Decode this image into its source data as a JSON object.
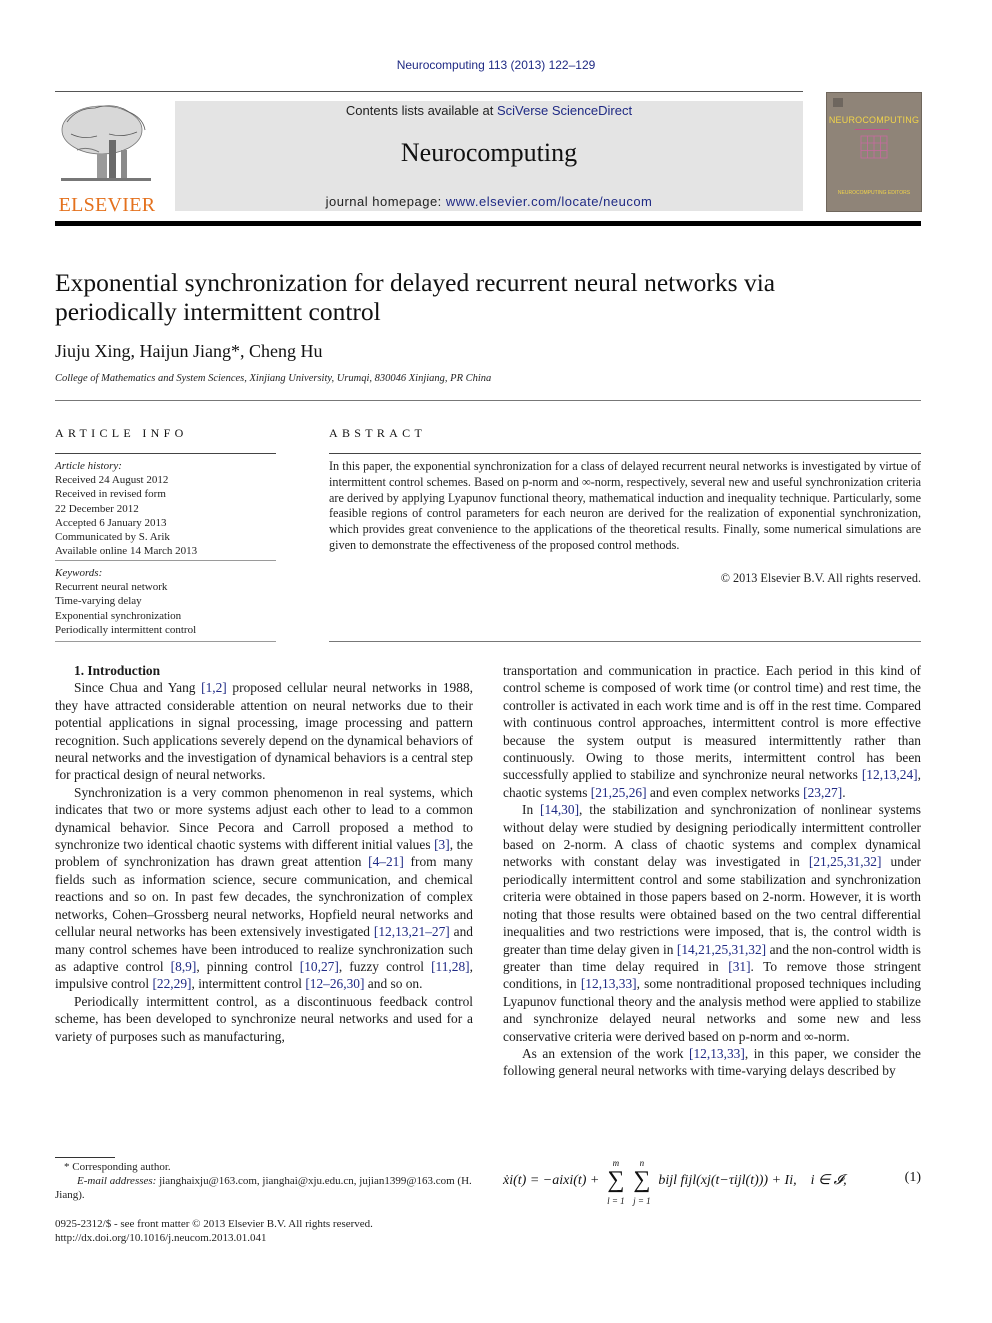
{
  "header": {
    "citation": "Neurocomputing 113 (2013) 122–129",
    "publisher_logo": "ELSEVIER",
    "contents_prefix": "Contents lists available at ",
    "contents_link": "SciVerse ScienceDirect",
    "journal_name": "Neurocomputing",
    "homepage_prefix": "journal homepage: ",
    "homepage_link": "www.elsevier.com/locate/neucom",
    "cover_title": "NEUROCOMPUTING",
    "cover_editors": "NEUROCOMPUTING EDITORS",
    "colors": {
      "link": "#1f2a84",
      "elsevier_orange": "#e4711d",
      "banner_bg": "#e4e4e4",
      "cover_bg": "#8f8478",
      "cover_text": "#f1d44a"
    }
  },
  "article": {
    "title": "Exponential synchronization for delayed recurrent neural networks via periodically intermittent control",
    "authors": "Jiuju Xing, Haijun Jiang*, Cheng Hu",
    "affiliation": "College of Mathematics and System Sciences, Xinjiang University, Urumqi, 830046 Xinjiang, PR China"
  },
  "article_info": {
    "heading": "ARTICLE INFO",
    "history_label": "Article history:",
    "history": [
      "Received 24 August 2012",
      "Received in revised form",
      "22 December 2012",
      "Accepted 6 January 2013",
      "Communicated by S. Arik",
      "Available online 14 March 2013"
    ],
    "keywords_label": "Keywords:",
    "keywords": [
      "Recurrent neural network",
      "Time-varying delay",
      "Exponential synchronization",
      "Periodically intermittent control"
    ]
  },
  "abstract": {
    "heading": "ABSTRACT",
    "text": "In this paper, the exponential synchronization for a class of delayed recurrent neural networks is investigated by virtue of intermittent control schemes. Based on p-norm and ∞-norm, respectively, several new and useful synchronization criteria are derived by applying Lyapunov functional theory, mathematical induction and inequality technique. Particularly, some feasible regions of control parameters for each neuron are derived for the realization of exponential synchronization, which provides great convenience to the applications of the theoretical results. Finally, some numerical simulations are given to demonstrate the effectiveness of the proposed control methods.",
    "copyright": "© 2013 Elsevier B.V. All rights reserved."
  },
  "body": {
    "section_title": "1.  Introduction",
    "left_paragraphs": [
      [
        "Since Chua and Yang ",
        {
          "ref": "[1,2]"
        },
        " proposed cellular neural networks in 1988, they have attracted considerable attention on neural networks due to their potential applications in signal processing, image processing and pattern recognition. Such applications severely depend on the dynamical behaviors of neural networks and the investigation of dynamical behaviors is a central step for practical design of neural networks."
      ],
      [
        "Synchronization is a very common phenomenon in real systems, which indicates that two or more systems adjust each other to lead to a common dynamical behavior. Since Pecora and Carroll proposed a method to synchronize two identical chaotic systems with different initial values ",
        {
          "ref": "[3]"
        },
        ", the problem of synchronization has drawn great attention ",
        {
          "ref": "[4–21]"
        },
        " from many fields such as information science, secure communication, and chemical reactions and so on. In past few decades, the synchronization of complex networks, Cohen–Grossberg neural networks, Hopfield neural networks and cellular neural networks has been extensively investigated ",
        {
          "ref": "[12,13,21–27]"
        },
        " and many control schemes have been introduced to realize synchronization such as adaptive control ",
        {
          "ref": "[8,9]"
        },
        ", pinning control ",
        {
          "ref": "[10,27]"
        },
        ", fuzzy control ",
        {
          "ref": "[11,28]"
        },
        ", impulsive control ",
        {
          "ref": "[22,29]"
        },
        ", intermittent control ",
        {
          "ref": "[12–26,30]"
        },
        " and so on."
      ],
      [
        "Periodically intermittent control, as a discontinuous feedback control scheme, has been developed to synchronize neural networks and used for a variety of purposes such as manufacturing,"
      ]
    ],
    "right_paragraphs": [
      [
        "transportation and communication in practice. Each period in this kind of control scheme is composed of work time (or control time) and rest time, the controller is activated in each work time and is off in the rest time. Compared with continuous control approaches, intermittent control is more effective because the system output is measured intermittently rather than continuously. Owing to those merits, intermittent control has been successfully applied to stabilize and synchronize neural networks ",
        {
          "ref": "[12,13,24]"
        },
        ", chaotic systems ",
        {
          "ref": "[21,25,26]"
        },
        " and even complex networks ",
        {
          "ref": "[23,27]"
        },
        "."
      ],
      [
        "In ",
        {
          "ref": "[14,30]"
        },
        ", the stabilization and synchronization of nonlinear systems without delay were studied by designing periodically intermittent controller based on 2-norm. A class of chaotic systems and complex dynamical networks with constant delay was investigated in ",
        {
          "ref": "[21,25,31,32]"
        },
        " under periodically intermittent control and some stabilization and synchronization criteria were obtained in those papers based on 2-norm. However, it is worth noting that those results were obtained based on the two central differential inequalities and two restrictions were imposed, that is, the control width is greater than time delay given in ",
        {
          "ref": "[14,21,25,31,32]"
        },
        " and the non-control width is greater than time delay required in ",
        {
          "ref": "[31]"
        },
        ". To remove those stringent conditions, in ",
        {
          "ref": "[12,13,33]"
        },
        ", some nontraditional proposed techniques including Lyapunov functional theory and the analysis method were applied to stabilize and synchronize delayed neural networks and some new and less conservative criteria were derived based on p-norm and ∞-norm."
      ],
      [
        "As an extension of the work ",
        {
          "ref": "[12,13,33]"
        },
        ", in this paper, we consider the following general neural networks with time-varying delays described by"
      ]
    ],
    "equation": {
      "lhs": "ẋi(t) = −aixi(t) +",
      "sum1_upper": "m",
      "sum1_lower": "l = 1",
      "sum2_upper": "n",
      "sum2_lower": "j = 1",
      "rhs": "bijl fijl(xj(t−τijl(t))) + Ii,",
      "condition": "i ∈ 𝓘,",
      "number": "(1)"
    }
  },
  "footnotes": {
    "corresponding": "* Corresponding author.",
    "email_label": "E-mail addresses:",
    "emails": "jianghaixju@163.com, jianghai@xju.edu.cn, jujian1399@163.com (H. Jiang).",
    "issn_line": "0925-2312/$ - see front matter © 2013 Elsevier B.V. All rights reserved.",
    "doi": "http://dx.doi.org/10.1016/j.neucom.2013.01.041"
  }
}
